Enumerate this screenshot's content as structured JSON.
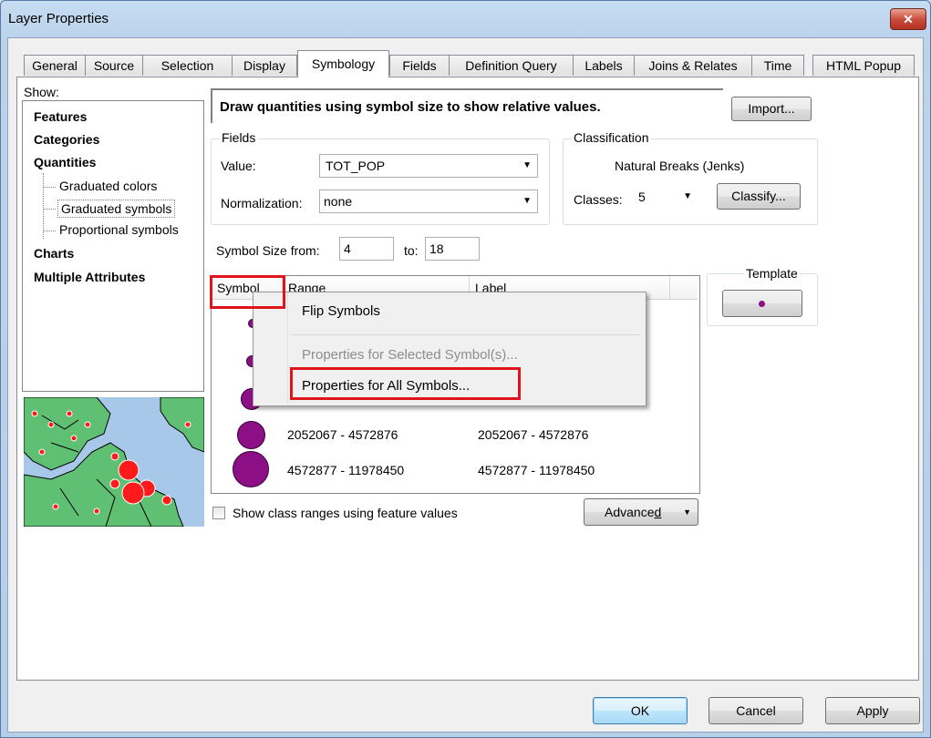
{
  "window": {
    "title": "Layer Properties",
    "close_glyph": "✕"
  },
  "tabs": [
    {
      "label": "General"
    },
    {
      "label": "Source"
    },
    {
      "label": "Selection"
    },
    {
      "label": "Display"
    },
    {
      "label": "Symbology"
    },
    {
      "label": "Fields"
    },
    {
      "label": "Definition Query"
    },
    {
      "label": "Labels"
    },
    {
      "label": "Joins & Relates"
    },
    {
      "label": "Time"
    },
    {
      "label": "HTML Popup"
    }
  ],
  "active_tab": "Symbology",
  "show": {
    "label": "Show:",
    "items": [
      "Features",
      "Categories",
      "Quantities",
      "Graduated colors",
      "Graduated symbols",
      "Proportional symbols",
      "Charts",
      "Multiple Attributes"
    ]
  },
  "description": "Draw quantities using symbol size to show relative values.",
  "import_label": "Import...",
  "fields": {
    "title": "Fields",
    "value_label": "Value:",
    "value": "TOT_POP",
    "normalization_label": "Normalization:",
    "normalization": "none"
  },
  "classification": {
    "title": "Classification",
    "method": "Natural Breaks (Jenks)",
    "classes_label": "Classes:",
    "classes": "5",
    "classify_label": "Classify..."
  },
  "symbol_size": {
    "from_label": "Symbol Size from:",
    "from": "4",
    "to_label": "to:",
    "to": "18"
  },
  "template": {
    "title": "Template"
  },
  "table": {
    "headers": [
      "Symbol",
      "Range",
      "Label"
    ],
    "rows": [
      {
        "range": "2052067 - 4572876",
        "label": "2052067 - 4572876"
      },
      {
        "range": "4572877 - 11978450",
        "label": "4572877 - 11978450"
      }
    ]
  },
  "context_menu": {
    "items": [
      "Flip Symbols",
      "Properties for Selected Symbol(s)...",
      "Properties for All Symbols..."
    ]
  },
  "show_class_ranges_label": "Show class ranges using feature values",
  "advanced_label": "Advance",
  "advanced_mnemonic": "d",
  "buttons": {
    "ok": "OK",
    "cancel": "Cancel",
    "apply": "Apply"
  },
  "colors": {
    "accent_red": "#e0151b",
    "symbol_purple": "#8c0f86",
    "map_land": "#5fbf73",
    "map_water": "#a8c8ea"
  }
}
